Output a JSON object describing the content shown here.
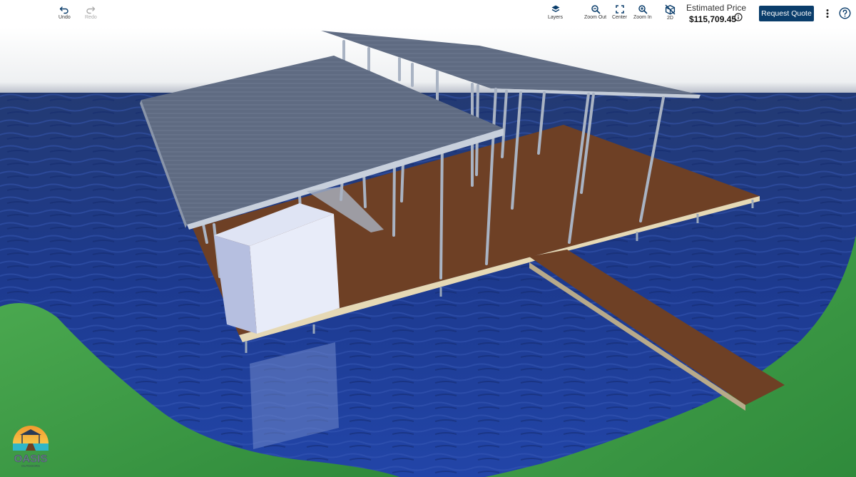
{
  "toolbar": {
    "undo_label": "Undo",
    "redo_label": "Redo",
    "layers_label": "Layers",
    "zoom_out_label": "Zoom Out",
    "center_label": "Center",
    "zoom_in_label": "Zoom In",
    "view_2d_label": "2D"
  },
  "price": {
    "label": "Estimated Price",
    "value": "$115,709.45"
  },
  "actions": {
    "request_quote_label": "Request Quote"
  },
  "logo": {
    "text": "OASIS",
    "subtext": "OUTDOORS"
  },
  "colors": {
    "quote_button": "#0a3d6b",
    "water": "#1c3a8a",
    "grass": "#3f9b48",
    "deck": "#6e4025",
    "roof": "#5d6a80"
  }
}
